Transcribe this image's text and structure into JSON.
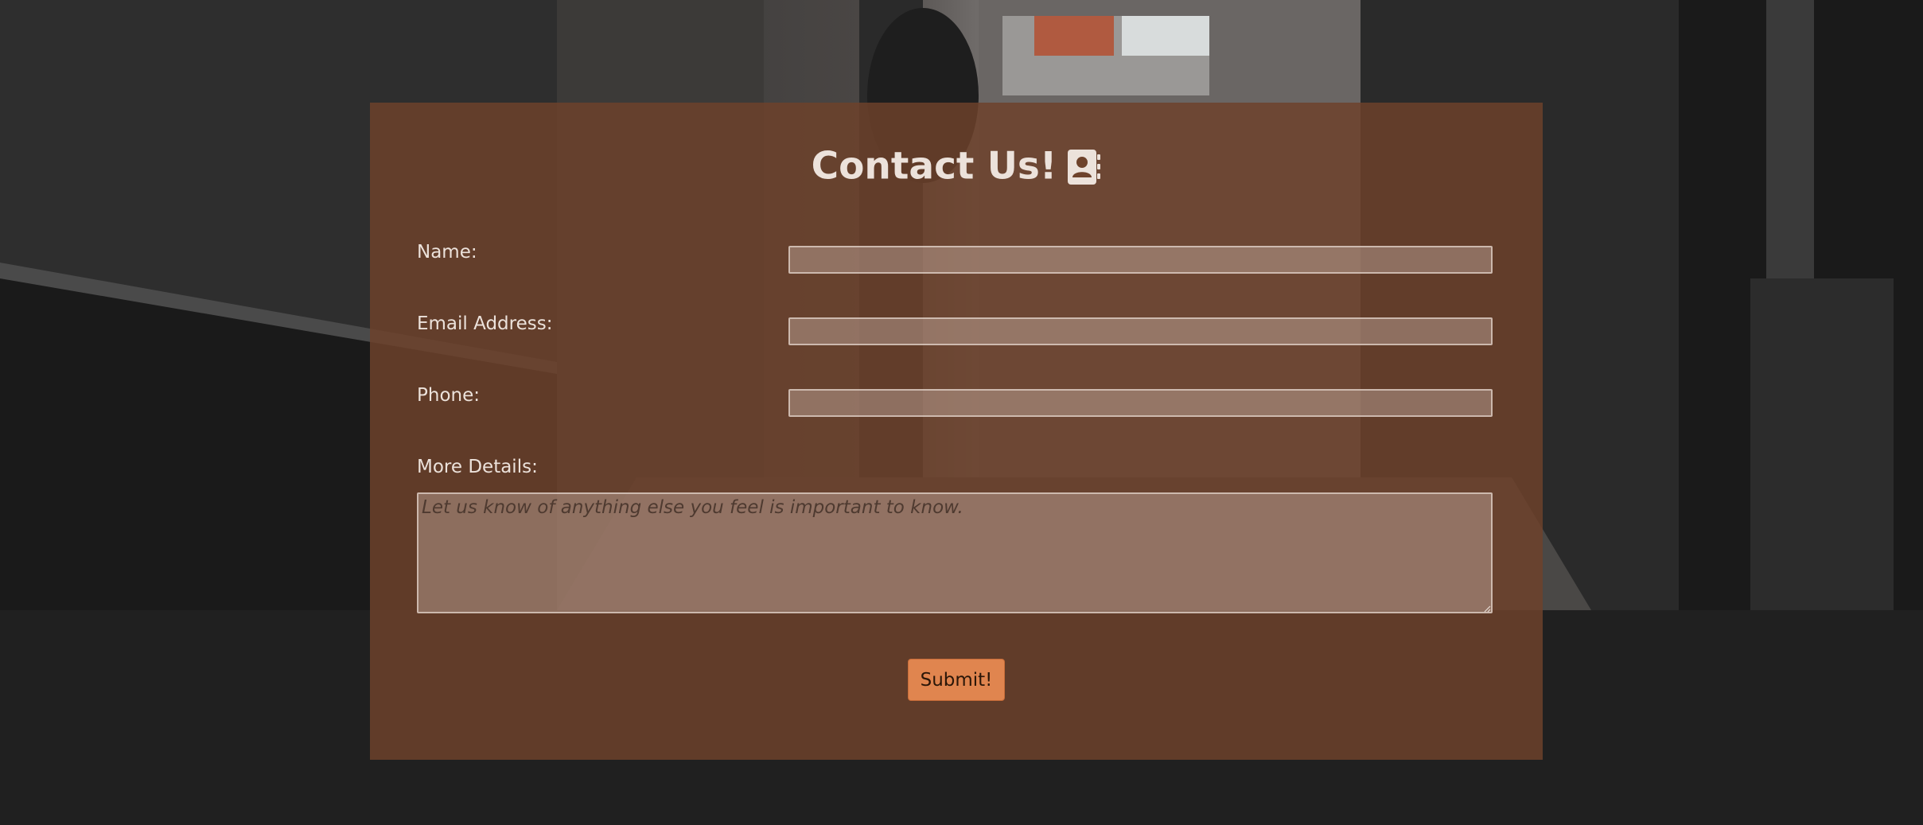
{
  "form": {
    "title": "Contact Us!",
    "title_icon": "address-book-icon",
    "fields": {
      "name_label": "Name:",
      "email_label": "Email Address:",
      "phone_label": "Phone:",
      "details_label": "More Details:",
      "details_placeholder": "Let us know of anything else you feel is important to know."
    },
    "submit_label": "Submit!"
  },
  "colors": {
    "page_background": "#202020",
    "card_background": "#6e422b",
    "accent_button": "#e0854f",
    "text_light": "#ece2db"
  }
}
